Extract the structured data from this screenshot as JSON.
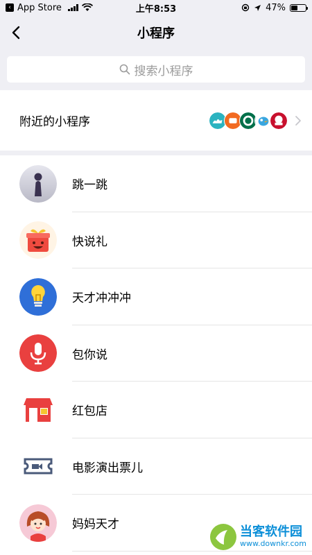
{
  "status_bar": {
    "back_app": "App Store",
    "time": "上午8:53",
    "battery_percent": "47%",
    "battery_level": 0.47
  },
  "nav": {
    "title": "小程序"
  },
  "search": {
    "placeholder": "搜索小程序"
  },
  "nearby": {
    "label": "附近的小程序",
    "logos": [
      "camel-logo",
      "food-logo",
      "starbucks-logo",
      "bird-logo",
      "kfc-logo"
    ]
  },
  "apps": [
    {
      "name": "跳一跳",
      "icon": "chess-piece-icon"
    },
    {
      "name": "快说礼",
      "icon": "gift-box-icon"
    },
    {
      "name": "天才冲冲冲",
      "icon": "light-bulb-icon"
    },
    {
      "name": "包你说",
      "icon": "microphone-icon"
    },
    {
      "name": "红包店",
      "icon": "shop-icon"
    },
    {
      "name": "电影演出票儿",
      "icon": "ticket-icon"
    },
    {
      "name": "妈妈天才",
      "icon": "mom-avatar-icon"
    }
  ],
  "watermark": {
    "name": "当客软件园",
    "url": "www.downkr.com"
  },
  "colors": {
    "accent_red": "#e9403f",
    "separator": "#e5e5e5",
    "background": "#efeff4"
  }
}
